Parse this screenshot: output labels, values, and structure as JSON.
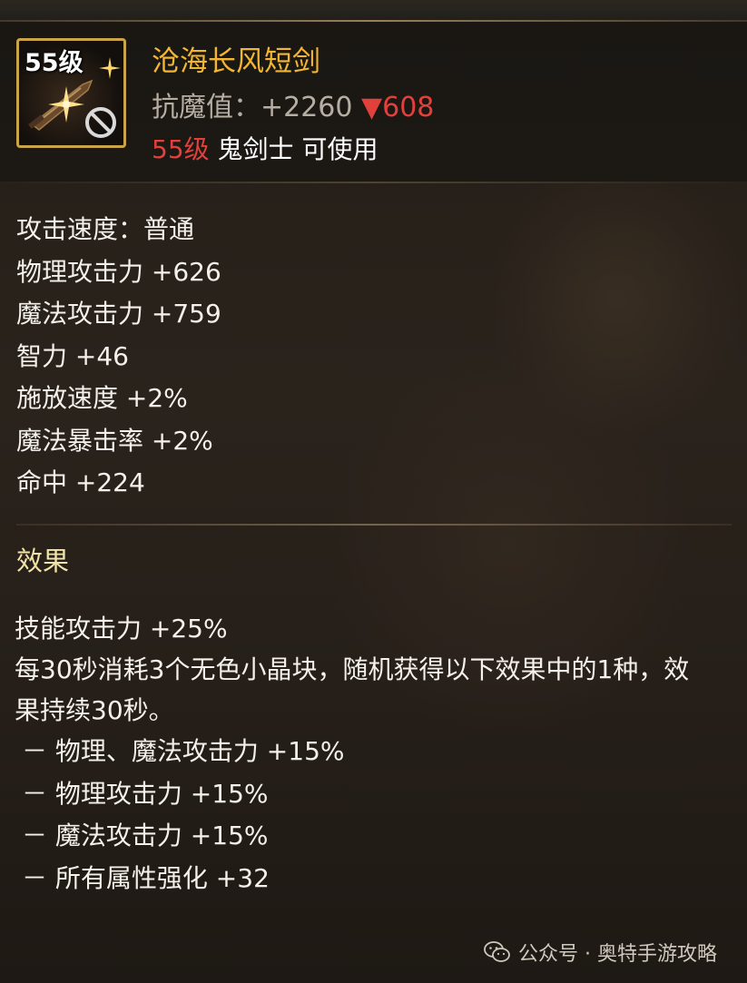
{
  "item": {
    "icon_level": "55级",
    "name": "沧海长风短剑",
    "resist_label": "抗魔值：",
    "resist_value": "+2260",
    "resist_diff": "▼608",
    "req_level": "55级",
    "req_class": "鬼剑士 可使用",
    "icon_name": "sword-icon",
    "status_icon": "no-entry-icon"
  },
  "stats": [
    "攻击速度：普通",
    "物理攻击力 +626",
    "魔法攻击力 +759",
    "智力 +46",
    "施放速度 +2%",
    "魔法暴击率 +2%",
    "命中 +224"
  ],
  "effect": {
    "title": "效果",
    "lines": [
      "技能攻击力 +25%",
      "每30秒消耗3个无色小晶块，随机获得以下效果中的1种，效",
      "果持续30秒。"
    ],
    "bullets": [
      "－ 物理、魔法攻击力 +15%",
      "－ 物理攻击力 +15%",
      "－ 魔法攻击力 +15%",
      "－ 所有属性强化 +32"
    ]
  },
  "watermark": {
    "text": "公众号 · 奥特手游攻略",
    "icon": "wechat-icon"
  },
  "colors": {
    "item_name": "#f2b632",
    "icon_border": "#c9a449",
    "negative": "#e2403b",
    "effect_title": "#f2e3a8",
    "text": "#f4f0ea",
    "muted": "#b7aea3"
  }
}
